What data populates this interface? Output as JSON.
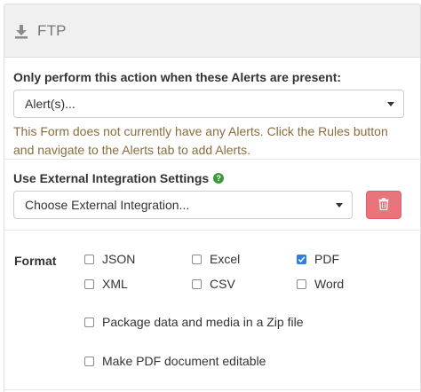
{
  "header": {
    "title": "FTP",
    "icon": "download-icon"
  },
  "alerts": {
    "label": "Only perform this action when these Alerts are present:",
    "select_value": "Alert(s)...",
    "help_text": "This Form does not currently have any Alerts. Click the Rules button and navigate to the Alerts tab to add Alerts."
  },
  "integration": {
    "label": "Use External Integration Settings",
    "help_icon": "?",
    "select_value": "Choose External Integration...",
    "delete_icon": "trash-icon"
  },
  "format": {
    "label": "Format",
    "options": [
      {
        "label": "JSON",
        "checked": false
      },
      {
        "label": "Excel",
        "checked": false
      },
      {
        "label": "PDF",
        "checked": true
      },
      {
        "label": "XML",
        "checked": false
      },
      {
        "label": "CSV",
        "checked": false
      },
      {
        "label": "Word",
        "checked": false
      }
    ],
    "zip_label": "Package data and media in a Zip file",
    "zip_checked": false,
    "pdf_editable_label": "Make PDF document editable",
    "pdf_editable_checked": false
  },
  "colors": {
    "delete_button": "#e8747c",
    "help_text": "#8a6d3b",
    "checkbox_checked": "#2f7ee0",
    "help_icon": "#3c9a3c"
  }
}
